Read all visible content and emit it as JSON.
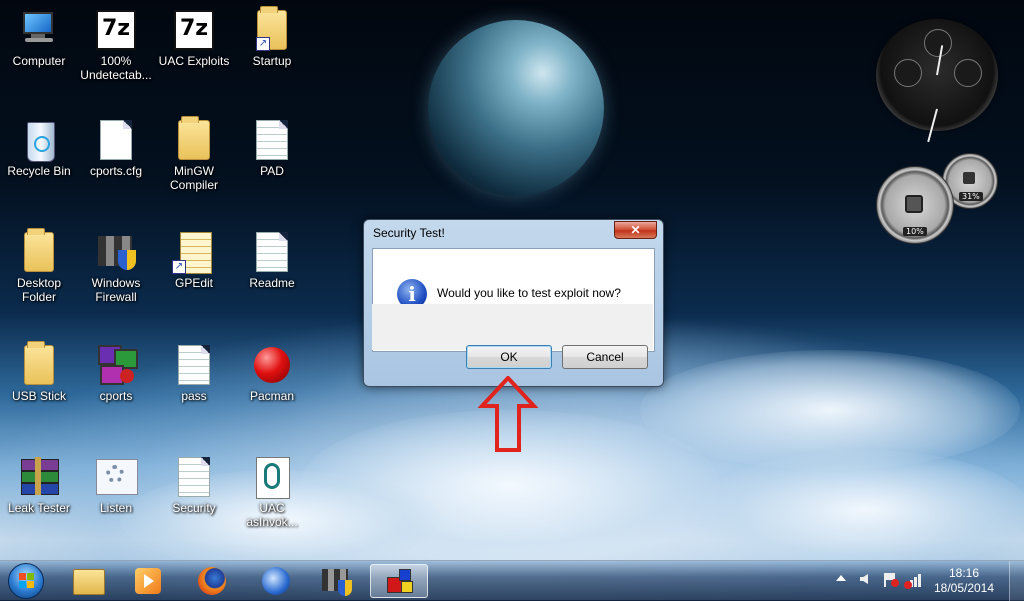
{
  "desktop": {
    "icons": [
      {
        "label": "Computer"
      },
      {
        "label": "100%\nUndetectab..."
      },
      {
        "label": "UAC Exploits"
      },
      {
        "label": "Startup"
      },
      {
        "label": "Recycle Bin"
      },
      {
        "label": "cports.cfg"
      },
      {
        "label": "MinGW\nCompiler"
      },
      {
        "label": "PAD"
      },
      {
        "label": "Desktop\nFolder"
      },
      {
        "label": "Windows\nFirewall"
      },
      {
        "label": "GPEdit"
      },
      {
        "label": "Readme"
      },
      {
        "label": "USB Stick"
      },
      {
        "label": "cports"
      },
      {
        "label": "pass"
      },
      {
        "label": "Pacman"
      },
      {
        "label": "Leak Tester"
      },
      {
        "label": "Listen"
      },
      {
        "label": "Security"
      },
      {
        "label": "UAC\nasInvok..."
      }
    ]
  },
  "gadgets": {
    "cpu_percent": "10%",
    "ram_percent": "31%"
  },
  "dialog": {
    "title": "Security Test!",
    "close_symbol": "✕",
    "message": "Would you like to test exploit now?",
    "info_symbol": "i",
    "ok_label": "OK",
    "cancel_label": "Cancel"
  },
  "annotation": {
    "arrow_color": "#e0231c"
  },
  "taskbar": {
    "clock_time": "18:16",
    "clock_date": "18/05/2014"
  }
}
